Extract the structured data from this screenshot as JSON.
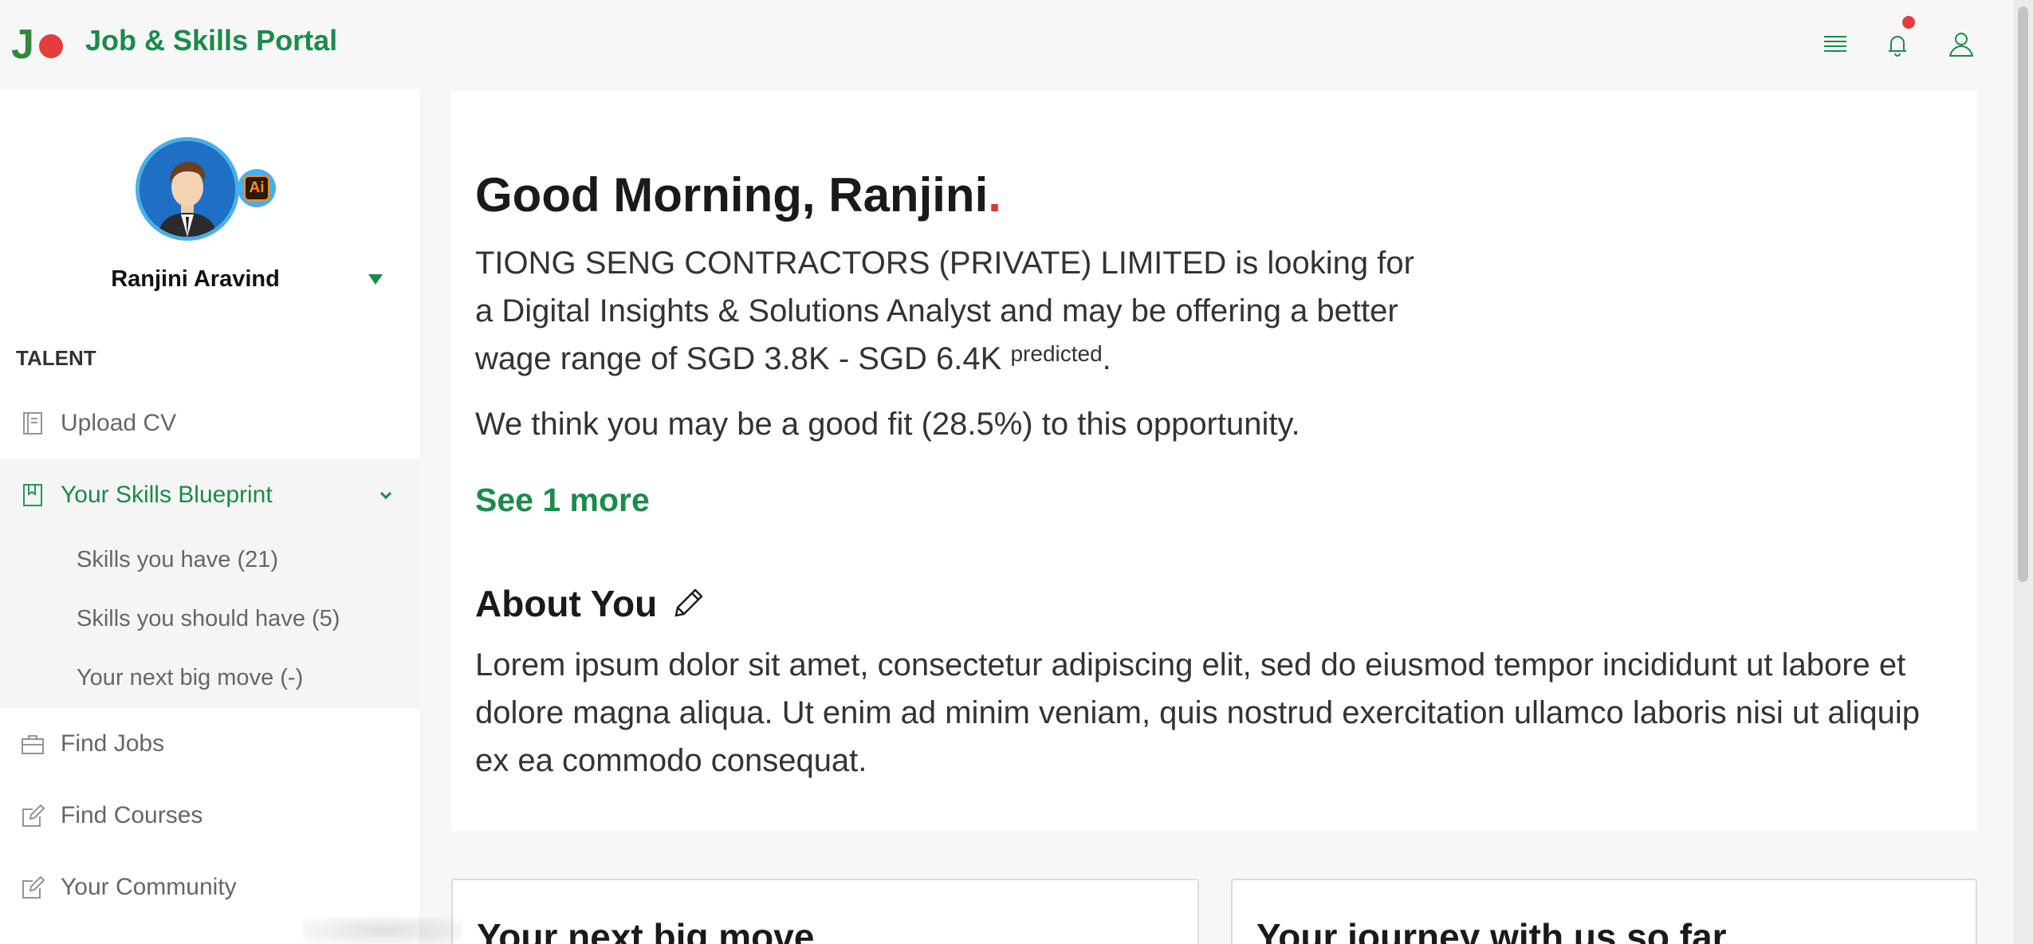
{
  "header": {
    "logo_letter": "J",
    "app_title": "Job & Skills Portal",
    "icons": [
      "menu-icon",
      "bell-icon",
      "user-icon"
    ],
    "has_notification": true
  },
  "colors": {
    "brand_green": "#1b8a4a",
    "accent_red": "#e53c3c",
    "avatar_ring": "#4aaee8"
  },
  "sidebar": {
    "user_name": "Ranjini Aravind",
    "ai_badge": "Ai",
    "section_label": "TALENT",
    "items": [
      {
        "label": "Upload CV",
        "icon": "document-icon"
      },
      {
        "label": "Your Skills Blueprint",
        "icon": "bookmark-icon",
        "active": true
      },
      {
        "label": "Find Jobs",
        "icon": "briefcase-icon"
      },
      {
        "label": "Find Courses",
        "icon": "edit-icon"
      },
      {
        "label": "Your Community",
        "icon": "edit-icon"
      }
    ],
    "sub_items": [
      {
        "label": "Skills you have (21)"
      },
      {
        "label": "Skills you should have (5)"
      },
      {
        "label": "Your next big move (-)"
      }
    ]
  },
  "main": {
    "greeting": "Good Morning, Ranjini",
    "greeting_dot": ".",
    "job_text": "TIONG SENG CONTRACTORS (PRIVATE) LIMITED is looking for a Digital Insights & Solutions Analyst and may be offering a better wage range of SGD 3.8K - SGD 6.4K",
    "predicted": "predicted",
    "job_text_end": ".",
    "fit_text": "We think you may be a good fit (28.5%) to this opportunity.",
    "see_more": "See 1 more",
    "about_title": "About You",
    "about_text": "Lorem ipsum dolor sit amet, consectetur adipiscing elit, sed do eiusmod tempor incididunt ut labore et dolore magna aliqua. Ut enim ad minim veniam, quis nostrud exercitation ullamco laboris nisi ut aliquip ex ea commodo consequat."
  },
  "cards": {
    "next_move_title": "Your next big move",
    "journey_title": "Your journey with us so far"
  }
}
